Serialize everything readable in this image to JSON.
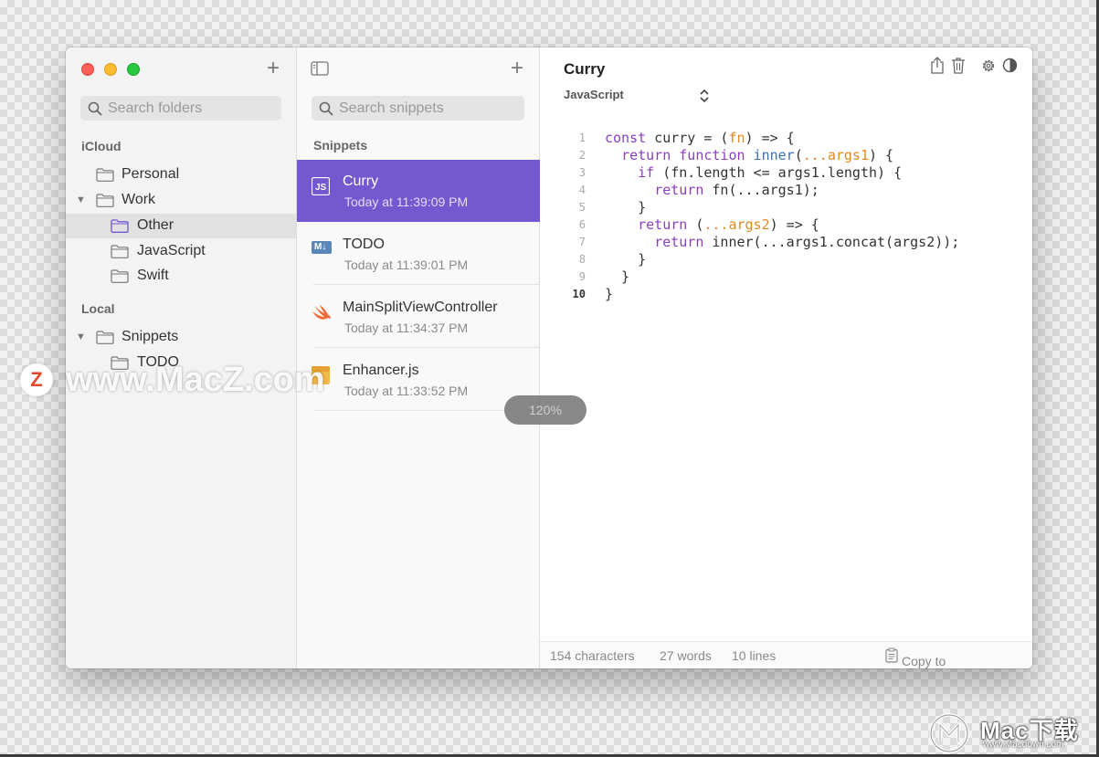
{
  "sidebar": {
    "search_placeholder": "Search folders",
    "sections": [
      {
        "label": "iCloud",
        "items": [
          {
            "label": "Personal"
          },
          {
            "label": "Work"
          },
          {
            "label": "Other",
            "selected": true
          },
          {
            "label": "JavaScript"
          },
          {
            "label": "Swift"
          }
        ]
      },
      {
        "label": "Local",
        "items": [
          {
            "label": "Snippets"
          },
          {
            "label": "TODO"
          }
        ]
      }
    ]
  },
  "snippets": {
    "search_placeholder": "Search snippets",
    "title": "Snippets",
    "items": [
      {
        "name": "Curry",
        "date": "Today at 11:39:09 PM",
        "badge": "JS",
        "selected": true
      },
      {
        "name": "TODO",
        "date": "Today at 11:39:01 PM",
        "badge": "M↓"
      },
      {
        "name": "MainSplitViewController",
        "date": "Today at 11:34:37 PM",
        "badge": "swift-icon"
      },
      {
        "name": "Enhancer.js",
        "date": "Today at 11:33:52 PM",
        "badge": "js-file-icon"
      }
    ]
  },
  "editor": {
    "title": "Curry",
    "language": "JavaScript",
    "line_numbers": [
      "1",
      "2",
      "3",
      "4",
      "5",
      "6",
      "7",
      "8",
      "9",
      "10"
    ],
    "current_line": 10,
    "code_lines": [
      "const curry = (fn) => {",
      "  return function inner(...args1) {",
      "    if (fn.length <= args1.length) {",
      "      return fn(...args1);",
      "    }",
      "    return (...args2) => {",
      "      return inner(...args1.concat(args2));",
      "    }",
      "  }",
      "}"
    ],
    "status": {
      "characters": "154 characters",
      "words": "27 words",
      "lines": "10 lines",
      "copy": "Copy to clipboard"
    },
    "toolbar_icons": [
      "share-icon",
      "trash-icon",
      "gear-icon",
      "appearance-icon"
    ]
  },
  "zoom": "120%",
  "watermarks": {
    "site": "www.MacZ.com",
    "logo_letter": "Z",
    "brand": "Mac下载",
    "brand_url": "www.Macdown.com"
  },
  "colors": {
    "accent": "#7358d0",
    "keyword": "#8a3fbf",
    "function": "#3d6fb5",
    "param": "#e08a1e"
  }
}
